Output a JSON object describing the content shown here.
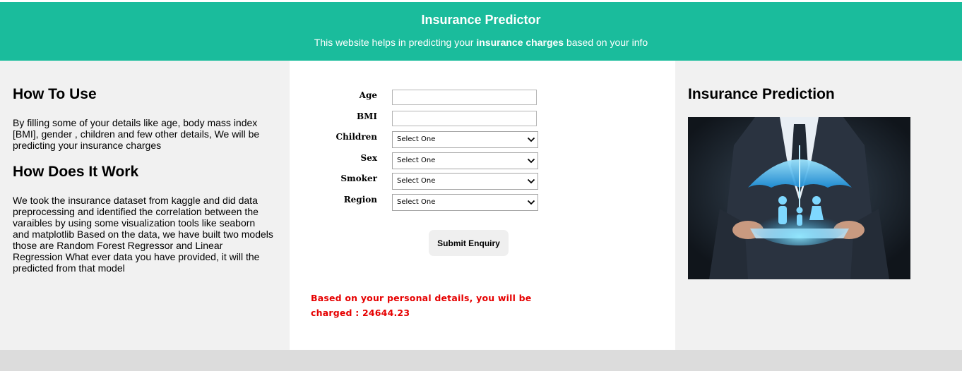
{
  "header": {
    "title": "Insurance Predictor",
    "subtitle_pre": "This website helps in predicting your ",
    "subtitle_bold": "insurance charges",
    "subtitle_post": " based on your info"
  },
  "left": {
    "how_to_use_title": "How To Use",
    "how_to_use_text": "By filling some of your details like age, body mass index [BMI], gender , children and few other details, We will be predicting your insurance charges",
    "how_it_works_title": "How Does It Work",
    "how_it_works_text": "We took the insurance dataset from kaggle and did data preprocessing and identified the correlation between the varaibles by using some visualization tools like seaborn and matplotlib Based on the data, we have built two models those are Random Forest Regressor and Linear Regression What ever data you have provided, it will the predicted from that model"
  },
  "form": {
    "age_label": "Age",
    "age_value": "",
    "bmi_label": "BMI",
    "bmi_value": "",
    "children_label": "Children",
    "children_selected": "Select One",
    "sex_label": "Sex",
    "sex_selected": "Select One",
    "smoker_label": "Smoker",
    "smoker_selected": "Select One",
    "region_label": "Region",
    "region_selected": "Select One",
    "submit_label": "Submit Enquiry"
  },
  "result": {
    "text": "Based on your personal details, you will be charged : 24644.23"
  },
  "right": {
    "title": "Insurance Prediction",
    "image_icon": "insurance-umbrella-family-image"
  },
  "colors": {
    "header_bg": "#1abc9c",
    "side_bg": "#f1f1f1",
    "result_text": "#e60000"
  }
}
